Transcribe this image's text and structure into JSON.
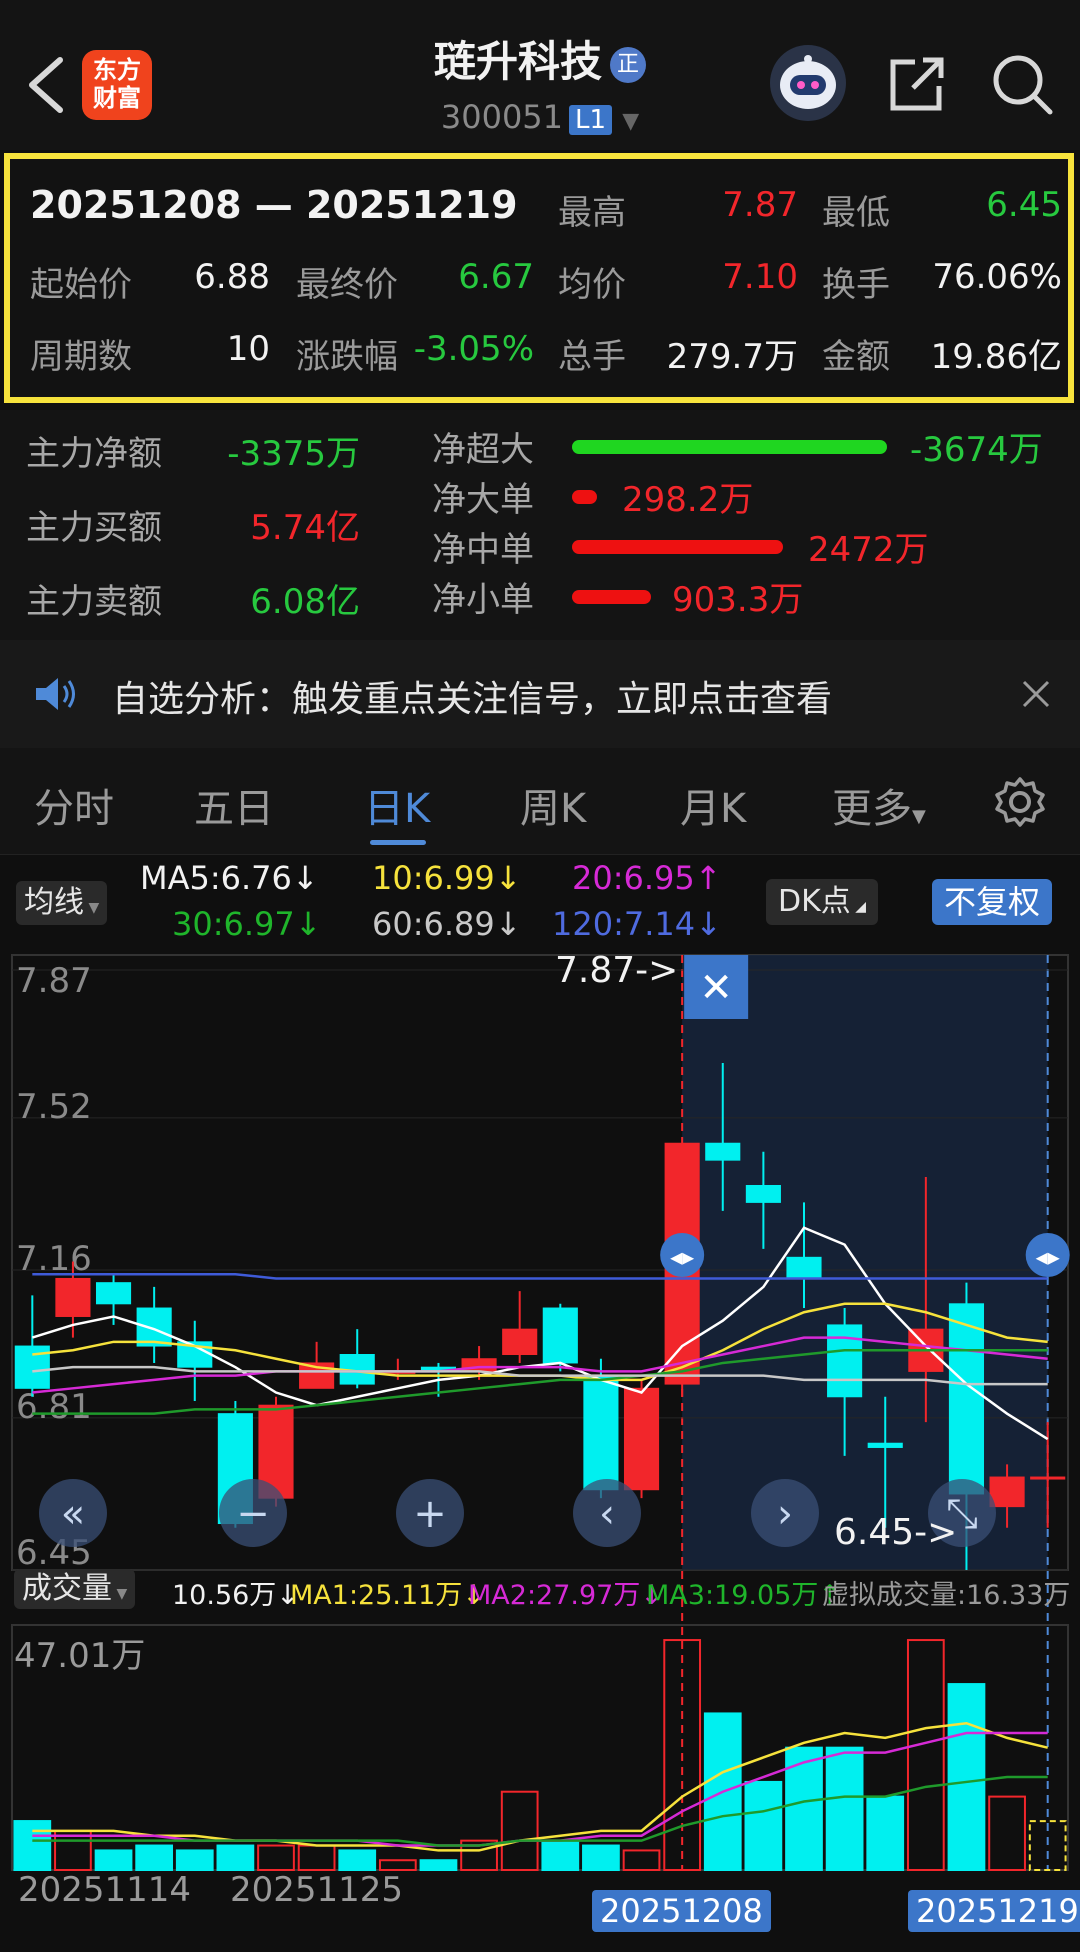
{
  "header": {
    "logo_text": "东方\n财富",
    "stock_name": "琏升科技",
    "badge": "正",
    "stock_code": "300051",
    "level_badge": "L1"
  },
  "summary": {
    "range": "20251208 — 20251219",
    "high_label": "最高",
    "high": "7.87",
    "low_label": "最低",
    "low": "6.45",
    "open_label": "起始价",
    "open": "6.88",
    "close_label": "最终价",
    "close": "6.67",
    "avg_label": "均价",
    "avg": "7.10",
    "turnover_label": "换手",
    "turnover": "76.06%",
    "periods_label": "周期数",
    "periods": "10",
    "change_label": "涨跌幅",
    "change": "-3.05%",
    "volume_label": "总手",
    "volume": "279.7万",
    "amount_label": "金额",
    "amount": "19.86亿"
  },
  "flows": {
    "main_net_label": "主力净额",
    "main_net": "-3375万",
    "main_buy_label": "主力买额",
    "main_buy": "5.74亿",
    "main_sell_label": "主力卖额",
    "main_sell": "6.08亿",
    "super_label": "净超大",
    "super": "-3674万",
    "super_ratio": 1.0,
    "large_label": "净大单",
    "large": "298.2万",
    "large_ratio": 0.08,
    "medium_label": "净中单",
    "medium": "2472万",
    "medium_ratio": 0.67,
    "small_label": "净小单",
    "small": "903.3万",
    "small_ratio": 0.25
  },
  "notice": {
    "text": "自选分析：触发重点关注信号，立即点击查看"
  },
  "tabs": [
    "分时",
    "五日",
    "日K",
    "周K",
    "月K",
    "更多"
  ],
  "active_tab": "日K",
  "ma_bar": {
    "mode": "均线",
    "ma5": "MA5:6.76↓",
    "ma10": "10:6.99↓",
    "ma20": "20:6.95↑",
    "ma30": "30:6.97↓",
    "ma60": "60:6.89↓",
    "ma120": "120:7.14↓",
    "dk": "DK点",
    "fq": "不复权"
  },
  "price_axis": [
    "7.87",
    "7.52",
    "7.16",
    "6.81",
    "6.45"
  ],
  "annotations": {
    "high": "7.87->",
    "low": "6.45->"
  },
  "volume_bar": {
    "mode": "成交量",
    "vol": "10.56万↓",
    "ma1": "MA1:25.11万↓",
    "ma2": "MA2:27.97万↓",
    "ma3": "MA3:19.05万↑",
    "virtual": "虚拟成交量:16.33万",
    "max_label": "47.01万"
  },
  "dates": [
    "20251114",
    "20251125",
    "20251208",
    "20251219"
  ],
  "colors": {
    "up": "#f2262b",
    "down": "#00f0f0",
    "highlight": "#f6e23c",
    "accent": "#4f8ad8"
  },
  "chart_data": {
    "type": "candlestick",
    "ylim": [
      6.45,
      7.87
    ],
    "candles": [
      {
        "o": 6.98,
        "c": 6.88,
        "h": 7.1,
        "l": 6.86
      },
      {
        "o": 7.05,
        "c": 7.14,
        "h": 7.18,
        "l": 7.0
      },
      {
        "o": 7.13,
        "c": 7.08,
        "h": 7.15,
        "l": 7.03
      },
      {
        "o": 7.07,
        "c": 6.98,
        "h": 7.12,
        "l": 6.94
      },
      {
        "o": 6.99,
        "c": 6.93,
        "h": 7.04,
        "l": 6.85
      },
      {
        "o": 6.82,
        "c": 6.56,
        "h": 6.85,
        "l": 6.55
      },
      {
        "o": 6.62,
        "c": 6.84,
        "h": 6.86,
        "l": 6.6
      },
      {
        "o": 6.88,
        "c": 6.94,
        "h": 6.99,
        "l": 6.88
      },
      {
        "o": 6.96,
        "c": 6.89,
        "h": 7.02,
        "l": 6.88
      },
      {
        "o": 6.92,
        "c": 6.92,
        "h": 6.95,
        "l": 6.9
      },
      {
        "o": 6.93,
        "c": 6.92,
        "h": 6.94,
        "l": 6.86
      },
      {
        "o": 6.92,
        "c": 6.95,
        "h": 6.98,
        "l": 6.9
      },
      {
        "o": 6.96,
        "c": 7.02,
        "h": 7.11,
        "l": 6.94
      },
      {
        "o": 7.07,
        "c": 6.94,
        "h": 7.08,
        "l": 6.92
      },
      {
        "o": 6.91,
        "c": 6.64,
        "h": 6.95,
        "l": 6.62
      },
      {
        "o": 6.64,
        "c": 6.88,
        "h": 6.9,
        "l": 6.62
      },
      {
        "o": 6.89,
        "c": 7.46,
        "h": 7.46,
        "l": 6.86
      },
      {
        "o": 7.46,
        "c": 7.42,
        "h": 7.65,
        "l": 7.3
      },
      {
        "o": 7.36,
        "c": 7.32,
        "h": 7.44,
        "l": 7.21
      },
      {
        "o": 7.19,
        "c": 7.14,
        "h": 7.32,
        "l": 7.07
      },
      {
        "o": 7.03,
        "c": 6.86,
        "h": 7.07,
        "l": 6.72
      },
      {
        "o": 6.75,
        "c": 6.74,
        "h": 6.86,
        "l": 6.55
      },
      {
        "o": 6.92,
        "c": 7.02,
        "h": 7.38,
        "l": 6.8
      },
      {
        "o": 7.08,
        "c": 6.63,
        "h": 7.13,
        "l": 6.45
      },
      {
        "o": 6.6,
        "c": 6.67,
        "h": 6.7,
        "l": 6.55
      },
      {
        "o": 6.67,
        "c": 6.67,
        "h": 6.8,
        "l": 6.55
      }
    ],
    "ma_series": [
      {
        "name": "MA5",
        "color": "#ffffff",
        "values": [
          7.0,
          7.03,
          7.05,
          7.02,
          6.98,
          6.93,
          6.87,
          6.84,
          6.86,
          6.88,
          6.9,
          6.91,
          6.93,
          6.94,
          6.9,
          6.87,
          6.98,
          7.04,
          7.12,
          7.26,
          7.22,
          7.08,
          6.98,
          6.89,
          6.82,
          6.76
        ]
      },
      {
        "name": "MA10",
        "color": "#f6e23c",
        "values": [
          6.96,
          6.97,
          6.99,
          6.99,
          6.98,
          6.97,
          6.95,
          6.93,
          6.92,
          6.91,
          6.91,
          6.91,
          6.91,
          6.91,
          6.9,
          6.9,
          6.93,
          6.97,
          7.02,
          7.06,
          7.08,
          7.08,
          7.06,
          7.03,
          7.0,
          6.99
        ]
      },
      {
        "name": "MA20",
        "color": "#d62ad6",
        "values": [
          6.87,
          6.88,
          6.89,
          6.9,
          6.91,
          6.91,
          6.92,
          6.92,
          6.92,
          6.92,
          6.92,
          6.93,
          6.93,
          6.93,
          6.92,
          6.92,
          6.94,
          6.96,
          6.98,
          7.0,
          7.0,
          6.99,
          6.98,
          6.97,
          6.96,
          6.95
        ]
      },
      {
        "name": "MA30",
        "color": "#1f9a2b",
        "values": [
          6.82,
          6.82,
          6.82,
          6.82,
          6.83,
          6.83,
          6.83,
          6.84,
          6.85,
          6.86,
          6.87,
          6.88,
          6.89,
          6.9,
          6.9,
          6.91,
          6.92,
          6.94,
          6.95,
          6.96,
          6.97,
          6.97,
          6.97,
          6.97,
          6.97,
          6.97
        ]
      },
      {
        "name": "MA60",
        "color": "#c8c8c8",
        "values": [
          6.92,
          6.93,
          6.93,
          6.93,
          6.92,
          6.92,
          6.92,
          6.92,
          6.92,
          6.92,
          6.92,
          6.92,
          6.91,
          6.91,
          6.91,
          6.91,
          6.91,
          6.91,
          6.91,
          6.9,
          6.9,
          6.9,
          6.9,
          6.89,
          6.89,
          6.89
        ]
      },
      {
        "name": "MA120",
        "color": "#3f5bd8",
        "values": [
          7.15,
          7.15,
          7.15,
          7.15,
          7.15,
          7.15,
          7.14,
          7.14,
          7.14,
          7.14,
          7.14,
          7.14,
          7.14,
          7.14,
          7.14,
          7.14,
          7.14,
          7.14,
          7.14,
          7.14,
          7.14,
          7.14,
          7.14,
          7.14,
          7.14,
          7.14
        ]
      }
    ],
    "volumes": [
      10,
      8,
      4,
      5,
      4,
      5,
      5,
      5,
      4,
      2,
      2,
      6,
      16,
      6,
      5,
      4,
      47,
      32,
      18,
      25,
      25,
      15,
      47,
      38,
      15,
      10
    ],
    "volume_ma": [
      {
        "name": "MA1",
        "color": "#f6e23c",
        "values": [
          8,
          8,
          8,
          7,
          7,
          6,
          6,
          5,
          5,
          5,
          4,
          4,
          6,
          7,
          8,
          8,
          15,
          20,
          23,
          26,
          28,
          27,
          29,
          30,
          27,
          25
        ]
      },
      {
        "name": "MA2",
        "color": "#d62ad6",
        "values": [
          7,
          7,
          7,
          7,
          6,
          6,
          6,
          6,
          6,
          5,
          5,
          5,
          6,
          6,
          7,
          7,
          12,
          16,
          19,
          22,
          24,
          24,
          26,
          28,
          28,
          28
        ]
      },
      {
        "name": "MA3",
        "color": "#1f9a2b",
        "values": [
          6,
          6,
          6,
          6,
          6,
          6,
          6,
          6,
          6,
          6,
          5,
          5,
          6,
          6,
          6,
          6,
          9,
          11,
          12,
          14,
          15,
          15,
          17,
          18,
          19,
          19
        ]
      }
    ],
    "volume_ylim": [
      0,
      47.01
    ]
  }
}
